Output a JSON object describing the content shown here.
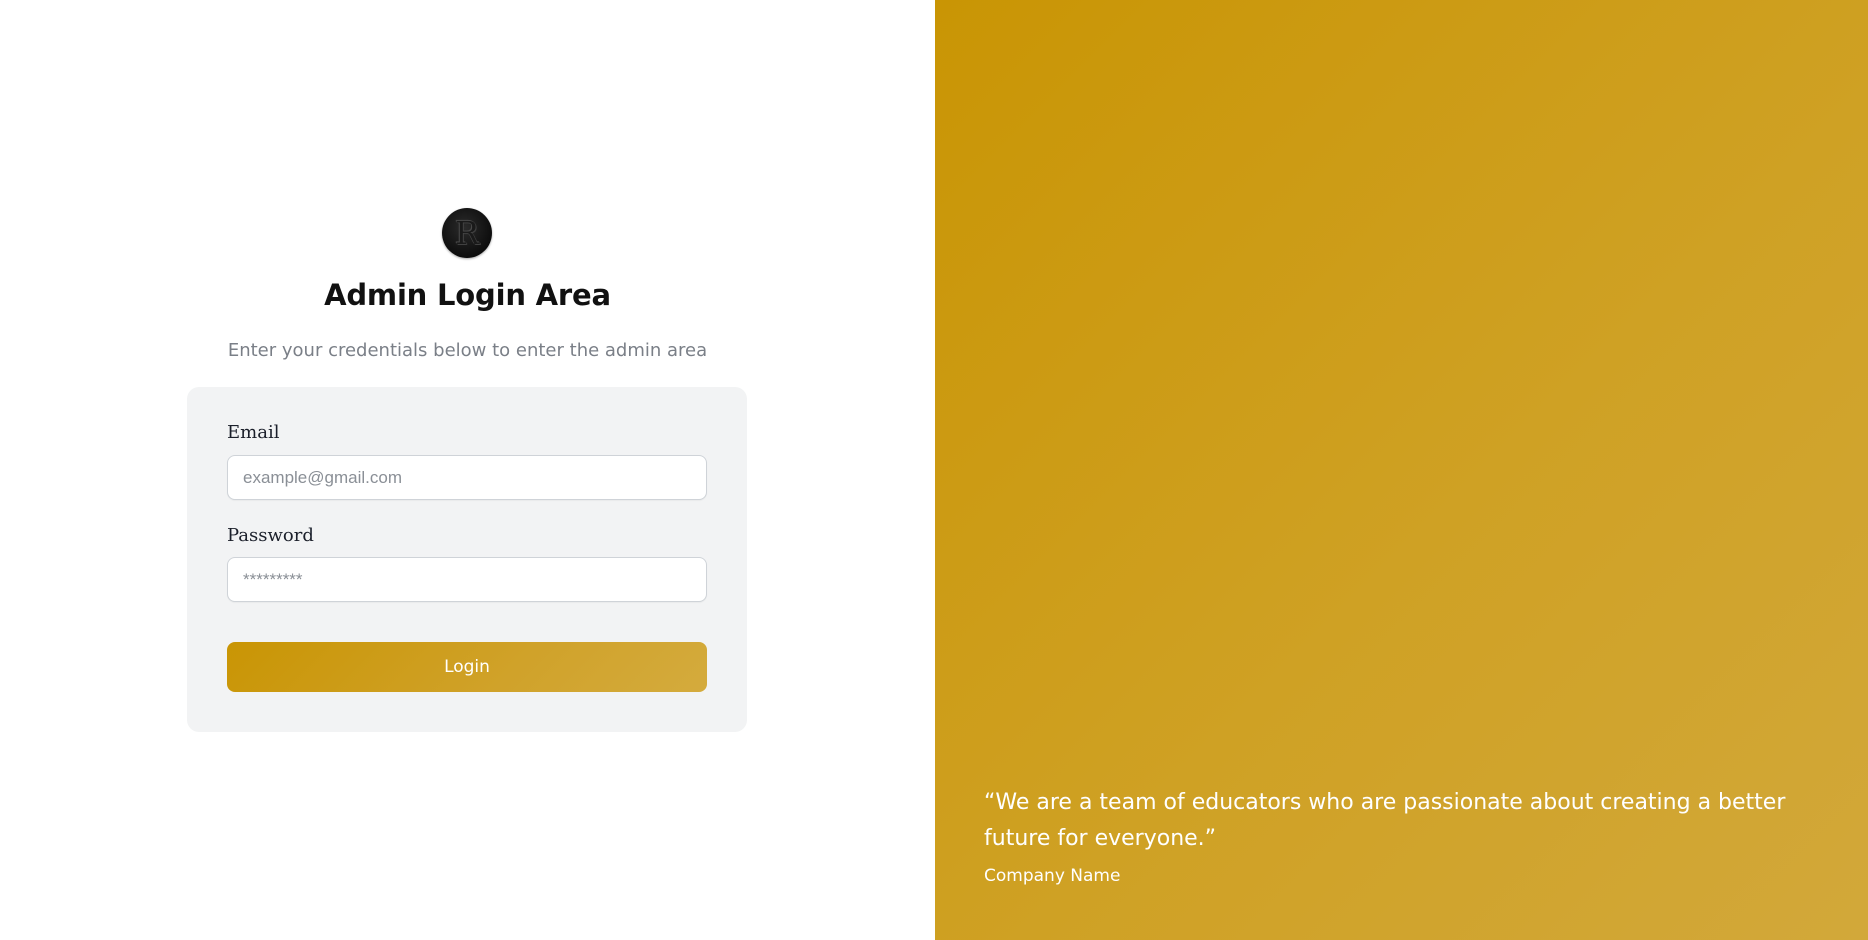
{
  "logo": {
    "letter": "R"
  },
  "header": {
    "title": "Admin Login Area",
    "subtitle": "Enter your credentials below to enter the admin area"
  },
  "form": {
    "email_label": "Email",
    "email_placeholder": "example@gmail.com",
    "email_value": "",
    "password_label": "Password",
    "password_placeholder": "*********",
    "password_value": "",
    "submit_label": "Login"
  },
  "testimonial": {
    "quote": "“We are a team of educators who are passionate about creating a better future for everyone.”",
    "author": "Company Name"
  },
  "colors": {
    "accent": "#c99504",
    "accent_light": "#d4ab3d",
    "card_bg": "#f2f3f4",
    "muted_text": "#7a7f87"
  }
}
